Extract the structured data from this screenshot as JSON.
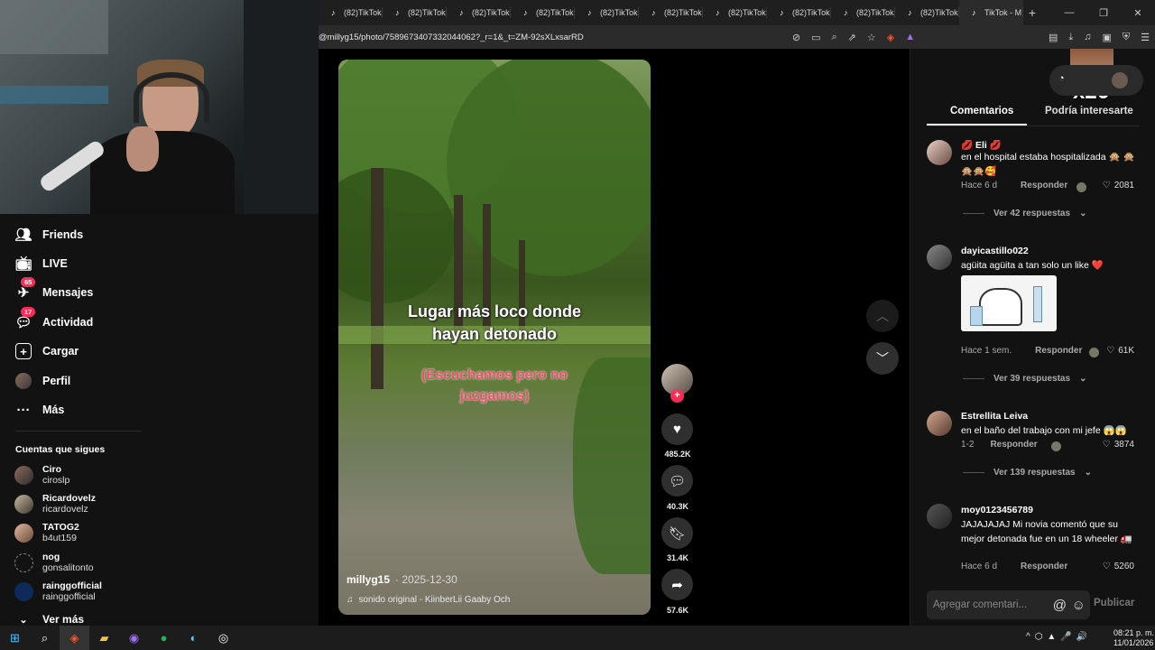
{
  "browser": {
    "tabs": [
      "(82)TikTok",
      "(82)TikTok",
      "(82)TikTok",
      "(82)TikTok",
      "(82)TikTok",
      "(82)TikTok",
      "(82)TikTok",
      "(82)TikTok",
      "(82)TikTok",
      "(82)TikTok",
      "TikTok - M"
    ],
    "url": "@millyg15/photo/7589673407332044062?_r=1&_t=ZM-92sXLxsarRD"
  },
  "sidebar": {
    "nav": [
      {
        "label": "Friends",
        "icon": "friends-icon",
        "badge": ""
      },
      {
        "label": "LIVE",
        "icon": "live-icon",
        "badge": ""
      },
      {
        "label": "Mensajes",
        "icon": "messages-icon",
        "badge": "65"
      },
      {
        "label": "Actividad",
        "icon": "activity-icon",
        "badge": "17"
      },
      {
        "label": "Cargar",
        "icon": "upload-icon",
        "badge": ""
      },
      {
        "label": "Perfil",
        "icon": "profile-icon",
        "badge": ""
      },
      {
        "label": "Más",
        "icon": "more-icon",
        "badge": ""
      }
    ],
    "following_title": "Cuentas que sigues",
    "following": [
      {
        "name": "Ciro",
        "user": "ciroslp"
      },
      {
        "name": "Ricardovelz",
        "user": "ricardovelz"
      },
      {
        "name": "TATOG2",
        "user": "b4ut159"
      },
      {
        "name": "nog",
        "user": "gonsalitonto"
      },
      {
        "name": "rainggofficial",
        "user": "rainggofficial"
      }
    ],
    "see_more": "Ver más"
  },
  "video": {
    "overlay_line1": "Lugar más loco donde",
    "overlay_line2": "hayan detonado",
    "overlay_pink1": "(Escuchamos pero no",
    "overlay_pink2": "juzgamos)",
    "username": "millyg15",
    "date": "· 2025-12-30",
    "sound": "sonido original - KiinberLii Gaaby Och"
  },
  "actions": {
    "likes": "485.2K",
    "comments": "40.3K",
    "saves": "31.4K",
    "shares": "57.6K"
  },
  "panel": {
    "overlay_badge": "x26",
    "tab_comments": "Comentarios",
    "tab_interest": "Podría interesarte",
    "comments": [
      {
        "name": "💋 Eli 💋",
        "text": "en el hospital estaba hospitalizada 🙊 🙊🙊🙊🥰",
        "time": "Hace 6 d",
        "reply": "Responder",
        "likes": "2081",
        "replies": "Ver 42 respuestas"
      },
      {
        "name": "dayicastillo022",
        "text": "agüita agüita a tan solo un like ❤️",
        "time": "Hace 1 sem.",
        "reply": "Responder",
        "likes": "61K",
        "replies": "Ver 39 respuestas"
      },
      {
        "name": "Estrellita Leiva",
        "text": "en el baño del trabajo con mi jefe 😱😱",
        "time": "1-2",
        "reply": "Responder",
        "likes": "3874",
        "replies": "Ver 139 respuestas"
      },
      {
        "name": "moy0123456789",
        "text": "JAJAJAJAJ Mi novia comentó que su mejor detonada fue en un 18 wheeler 🚛",
        "time": "Hace 6 d",
        "reply": "Responder",
        "likes": "5260",
        "replies": ""
      }
    ],
    "input_placeholder": "Agregar comentari...",
    "publish": "Publicar"
  },
  "taskbar": {
    "time": "08:21 p. m.",
    "date": "11/01/2026"
  },
  "colors": {
    "accent": "#fe2c55",
    "bg": "#121212"
  }
}
